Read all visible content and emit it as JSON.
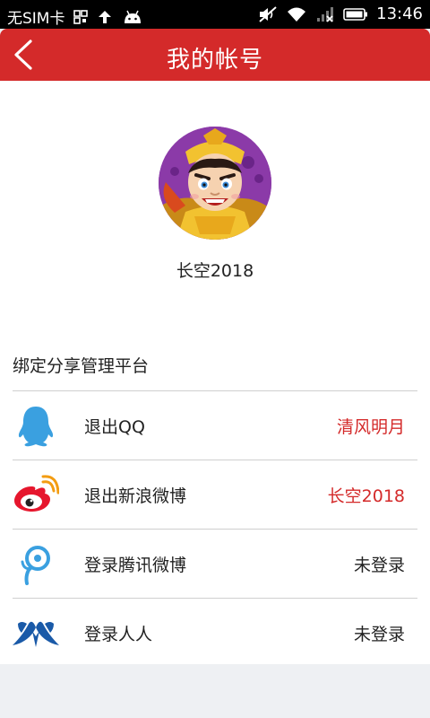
{
  "statusbar": {
    "carrier": "无SIM卡",
    "time": "13:46",
    "icons": [
      "grid-icon",
      "upload-arrow-icon",
      "android-icon",
      "mute-icon",
      "wifi-icon",
      "signal-icon",
      "battery-icon"
    ]
  },
  "header": {
    "title": "我的帐号",
    "back_icon": "chevron-left-icon"
  },
  "profile": {
    "username": "长空2018"
  },
  "share_section": {
    "title": "绑定分享管理平台",
    "items": [
      {
        "icon": "qq-penguin-icon",
        "label": "退出QQ",
        "status": "清风明月",
        "bound": true
      },
      {
        "icon": "sina-weibo-icon",
        "label": "退出新浪微博",
        "status": "长空2018",
        "bound": true
      },
      {
        "icon": "tencent-weibo-icon",
        "label": "登录腾讯微博",
        "status": "未登录",
        "bound": false
      },
      {
        "icon": "renren-icon",
        "label": "登录人人",
        "status": "未登录",
        "bound": false
      }
    ]
  },
  "colors": {
    "accent": "#d42a2a",
    "qq_blue": "#3aa0e0",
    "weibo_red": "#e6162d",
    "renren_blue": "#1a5aa8"
  }
}
